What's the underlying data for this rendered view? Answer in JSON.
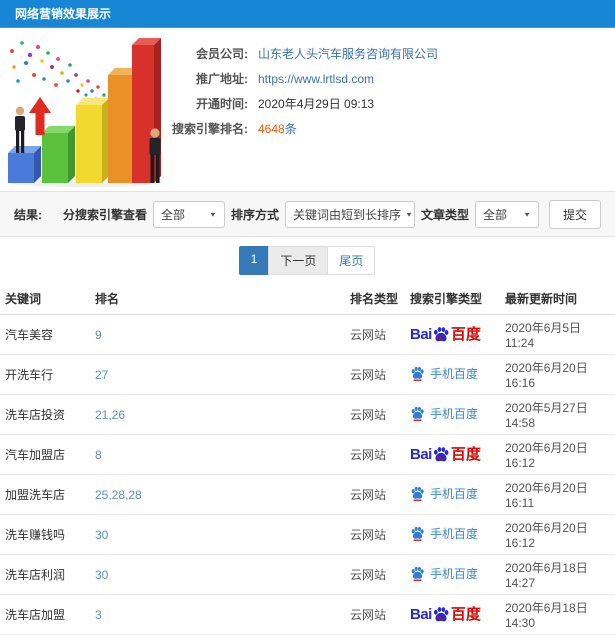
{
  "colors": {
    "header_bg": "#1787d5",
    "link_blue": "#3a72b4",
    "rank_blue": "#5b8fd0",
    "count_orange": "#ff5500",
    "baidu_blue": "#2529d8",
    "baidu_red": "#e10601",
    "mobile_baidu_blue": "#2f7bd9",
    "pagination_active": "#337ab7"
  },
  "header": {
    "title": "网络营销效果展示"
  },
  "info": {
    "illustration": "growth-bar-chart-with-businessmen",
    "company_label": "会员公司:",
    "company_value": "山东老人头汽车服务咨询有限公司",
    "url_label": "推广地址:",
    "url_value": "https://www.lrtlsd.com",
    "open_time_label": "开通时间:",
    "open_time_value": "2020年4月29日 09:13",
    "rank_count_label": "搜索引擎排名:",
    "rank_count_value": "4648",
    "rank_count_unit": "条"
  },
  "filters": {
    "section_label": "结果:",
    "engine_label": "分搜索引擎查看",
    "engine_value": "全部",
    "sort_label": "排序方式",
    "sort_value": "关键词由短到长排序",
    "article_label": "文章类型",
    "article_value": "全部",
    "submit_label": "提交"
  },
  "pagination": {
    "current": "1",
    "next_label": "下一页",
    "last_label": "尾页"
  },
  "table": {
    "headers": [
      "关键词",
      "排名",
      "排名类型",
      "搜索引擎类型",
      "最新更新时间"
    ],
    "rows": [
      {
        "keyword": "汽车美容",
        "rank": "9",
        "rank_type": "云网站",
        "engine": "baidu",
        "updated": "2020年6月5日 11:24"
      },
      {
        "keyword": "开洗车行",
        "rank": "27",
        "rank_type": "云网站",
        "engine": "mobile",
        "updated": "2020年6月20日 16:16"
      },
      {
        "keyword": "洗车店投资",
        "rank": "21,26",
        "rank_type": "云网站",
        "engine": "mobile",
        "updated": "2020年5月27日 14:58"
      },
      {
        "keyword": "汽车加盟店",
        "rank": "8",
        "rank_type": "云网站",
        "engine": "baidu",
        "updated": "2020年6月20日 16:12"
      },
      {
        "keyword": "加盟洗车店",
        "rank": "25,28,28",
        "rank_type": "云网站",
        "engine": "mobile",
        "updated": "2020年6月20日 16:11"
      },
      {
        "keyword": "洗车赚钱吗",
        "rank": "30",
        "rank_type": "云网站",
        "engine": "mobile",
        "updated": "2020年6月20日 16:12"
      },
      {
        "keyword": "洗车店利润",
        "rank": "30",
        "rank_type": "云网站",
        "engine": "mobile",
        "updated": "2020年6月18日 14:27"
      },
      {
        "keyword": "洗车店加盟",
        "rank": "3",
        "rank_type": "云网站",
        "engine": "baidu",
        "updated": "2020年6月18日 14:30"
      }
    ]
  },
  "engines": {
    "baidu": {
      "name": "百度",
      "text_bai": "Bai",
      "text_du": "du",
      "text_cn": "百度"
    },
    "mobile": {
      "name": "手机百度",
      "label": "手机百度"
    }
  }
}
